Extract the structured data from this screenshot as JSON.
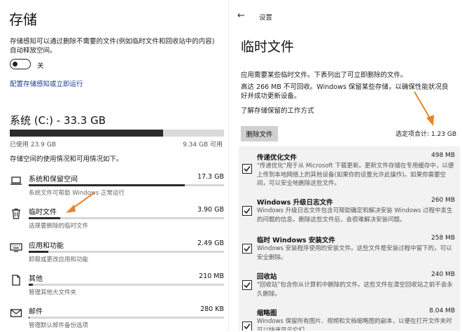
{
  "left": {
    "title": "存储",
    "description": "存储感知可以通过删除不需要的文件(例如临时文件和回收站中的内容)自动释放空间。",
    "toggle_label": "关",
    "config_link": "配置存储感知或立即运行",
    "drive_title": "系统 (C:) - 33.3 GB",
    "used_label": "已使用 23.9 GB",
    "free_label": "9.34 GB 可用",
    "used_fraction": 0.717,
    "drive_desc": "存储空间的使用情况和可用情况如下。",
    "categories": [
      {
        "icon": "laptop-icon",
        "name": "系统和保留空间",
        "size": "17.3 GB",
        "sub": "系统文件可帮助 Windows 正常运行",
        "fraction": 0.8
      },
      {
        "icon": "trash-icon",
        "name": "临时文件",
        "size": "3.90 GB",
        "sub": "选择要删除的临时文件",
        "fraction": 0.16
      },
      {
        "icon": "keyboard-icon",
        "name": "应用和功能",
        "size": "2.49 GB",
        "sub": "卸载或更改应用和功能",
        "fraction": 0.1
      },
      {
        "icon": "document-icon",
        "name": "其他",
        "size": "210 MB",
        "sub": "管理其他大文件夹",
        "fraction": 0.02
      },
      {
        "icon": "mail-icon",
        "name": "邮件",
        "size": "280 KB",
        "sub": "管理默认邮件备份选项",
        "fraction": 0.005
      }
    ]
  },
  "right": {
    "settings_label": "设置",
    "title": "临时文件",
    "desc1": "应用需要某些临时文件。下表列出了可立即删除的文件。",
    "desc2": "高达 266 MB 不可回收。Windows 保留某些存储，以确保性能状况良好并成功更新设备。",
    "link": "了解存储保留的工作方式",
    "delete_button": "删除文件",
    "selected_total": "选定项合计: 1.23 GB",
    "items": [
      {
        "name": "传递优化文件",
        "size": "498 MB",
        "desc": "\"传递优化\"用于从 Microsoft 下载更新。更新文件存储在专用缓存中，以便上传到本地网络上的其他设备(如果你的设置允许此操作)。如果你需要空间，可以安全地删除这些文件。"
      },
      {
        "name": "Windows 升级日志文件",
        "size": "260 MB",
        "desc": "Windows 升级日志文件包含可帮助确定和解决安装 Windows 过程中发生的问题的信息。删除这些文件后，会很难解决安装问题。"
      },
      {
        "name": "临时 Windows 安装文件",
        "size": "258 MB",
        "desc": "Windows 安装程序使用的安装文件。这些文件是安装过程中留下的，可以安全删除。"
      },
      {
        "name": "回收站",
        "size": "240 MB",
        "desc": "\"回收站\"包含你从计算机中删除的文件。这些文件在清空回收站之前不会永久删除。"
      },
      {
        "name": "缩略图",
        "size": "8.04 MB",
        "desc": "Windows 保留所有图片、视频和文档缩略图的副本，以便在打开文件夹时可以快速显示它们。"
      }
    ]
  },
  "colors": {
    "accent_arrow": "#e8832a",
    "bar_fill": "#2b2b2b",
    "bar_bg": "#dadada",
    "link": "#1a3d8f"
  }
}
